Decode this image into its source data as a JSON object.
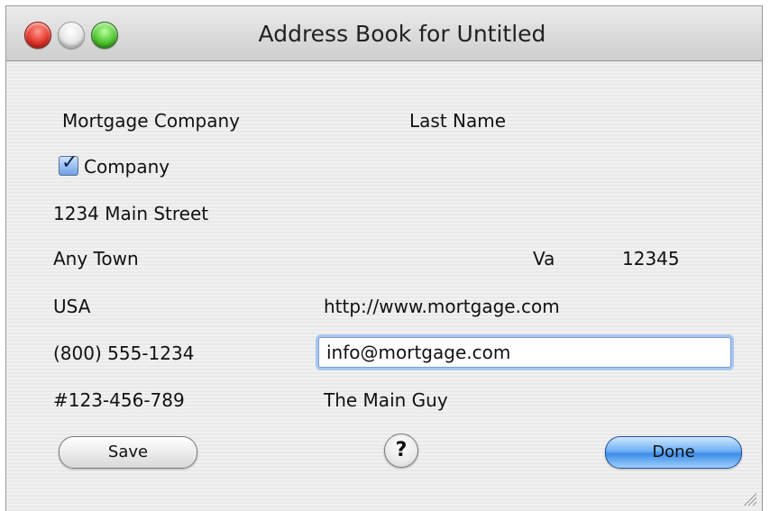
{
  "window": {
    "title": "Address Book for Untitled"
  },
  "form": {
    "company_name": "Mortgage Company",
    "last_name_label": "Last Name",
    "company_checkbox": {
      "label": "Company",
      "checked": true
    },
    "street": "1234 Main Street",
    "city": "Any Town",
    "state": "Va",
    "zip": "12345",
    "country": "USA",
    "website": "http://www.mortgage.com",
    "phone": "(800) 555-1234",
    "email": "info@mortgage.com",
    "account": "#123-456-789",
    "contact": "The Main Guy"
  },
  "buttons": {
    "save": "Save",
    "help": "?",
    "done": "Done"
  },
  "colors": {
    "accent": "#3e8de6",
    "close": "#e2352a",
    "zoom": "#4fc52f"
  }
}
